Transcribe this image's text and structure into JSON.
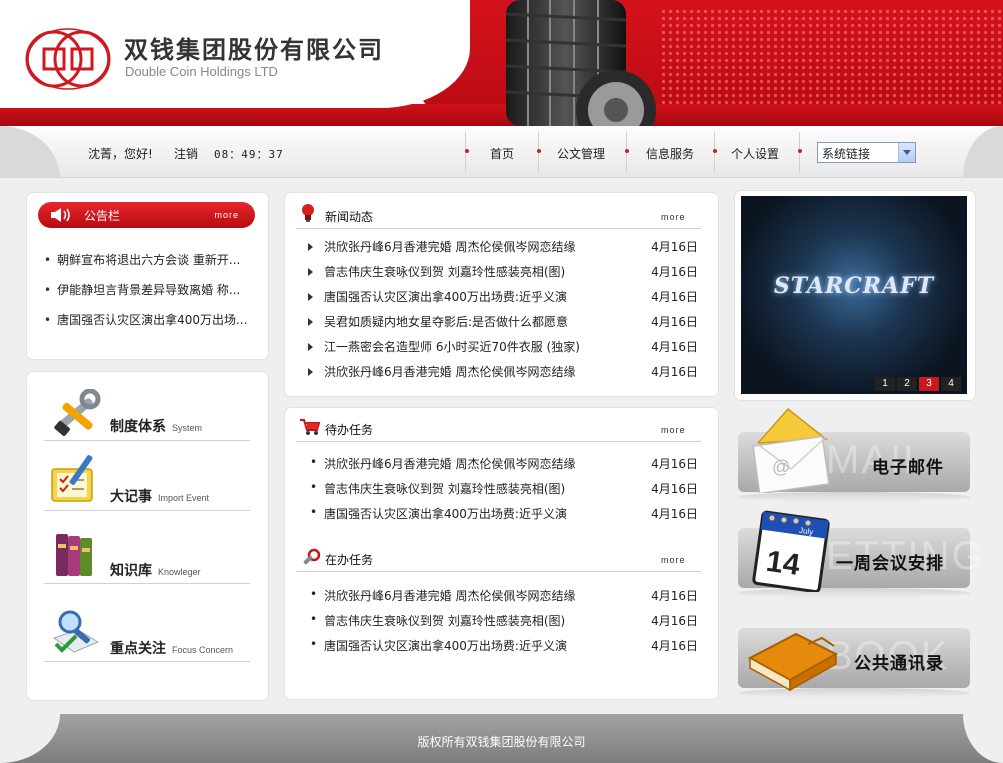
{
  "header": {
    "company_cn": "双钱集团股份有限公司",
    "company_en": "Double Coin Holdings LTD"
  },
  "userbar": {
    "greeting": "沈菁，您好!",
    "logout": "注销",
    "time": "08：49：37"
  },
  "nav": {
    "items": [
      "首页",
      "公文管理",
      "信息服务",
      "个人设置"
    ],
    "select_value": "系统链接"
  },
  "notice": {
    "title": "公告栏",
    "more": "more",
    "items": [
      "朝鲜宣布将退出六方会谈  重新开...",
      "伊能静坦言背景差异导致离婚  称...",
      "唐国强否认灾区演出拿400万出场..."
    ]
  },
  "categories": [
    {
      "cn": "制度体系",
      "en": "System",
      "icon": "tools-icon"
    },
    {
      "cn": "大记事",
      "en": "Import Event",
      "icon": "checklist-icon"
    },
    {
      "cn": "知识库",
      "en": "Knowleger",
      "icon": "books-icon"
    },
    {
      "cn": "重点关注",
      "en": "Focus Concern",
      "icon": "magnifier-icon"
    }
  ],
  "news": {
    "title": "新闻动态",
    "more": "more",
    "rows": [
      {
        "title": "洪欣张丹峰6月香港完婚  周杰伦侯佩岑网恋结缘",
        "date": "4月16日"
      },
      {
        "title": "曾志伟庆生衰咏仪到贺  刘嘉玲性感装亮相(图)",
        "date": "4月16日"
      },
      {
        "title": "唐国强否认灾区演出拿400万出场费:近乎义演",
        "date": "4月16日"
      },
      {
        "title": "吴君如质疑内地女星夺影后:是否做什么都愿意",
        "date": "4月16日"
      },
      {
        "title": "江一燕密会名造型师  6小时买近70件衣服 (独家)",
        "date": "4月16日"
      },
      {
        "title": "洪欣张丹峰6月香港完婚  周杰伦侯佩岑网恋结缘",
        "date": "4月16日"
      }
    ]
  },
  "todo": {
    "title": "待办任务",
    "more": "more",
    "rows": [
      {
        "title": "洪欣张丹峰6月香港完婚  周杰伦侯佩岑网恋结缘",
        "date": "4月16日"
      },
      {
        "title": "曾志伟庆生衰咏仪到贺  刘嘉玲性感装亮相(图)",
        "date": "4月16日"
      },
      {
        "title": "唐国强否认灾区演出拿400万出场费:近乎义演",
        "date": "4月16日"
      }
    ]
  },
  "doing": {
    "title": "在办任务",
    "more": "more",
    "rows": [
      {
        "title": "洪欣张丹峰6月香港完婚  周杰伦侯佩岑网恋结缘",
        "date": "4月16日"
      },
      {
        "title": "曾志伟庆生衰咏仪到贺  刘嘉玲性感装亮相(图)",
        "date": "4月16日"
      },
      {
        "title": "唐国强否认灾区演出拿400万出场费:近乎义演",
        "date": "4月16日"
      }
    ]
  },
  "banner": {
    "logo_text": "STARCRAFT",
    "pages": [
      "1",
      "2",
      "3",
      "4"
    ],
    "active_page": 3
  },
  "quick_links": [
    {
      "label": "电子邮件",
      "ghost": "MAIL",
      "icon": "envelope-icon"
    },
    {
      "label": "一周会议安排",
      "ghost": "ETTING",
      "icon": "calendar-icon",
      "calendar_day": "14",
      "calendar_month": "July"
    },
    {
      "label": "公共通讯录",
      "ghost": "BOOK",
      "icon": "address-book-icon"
    }
  ],
  "footer": {
    "copyright": "版权所有双钱集团股份有限公司"
  },
  "colors": {
    "brand_red": "#c81820",
    "active_page": "#c81820"
  }
}
